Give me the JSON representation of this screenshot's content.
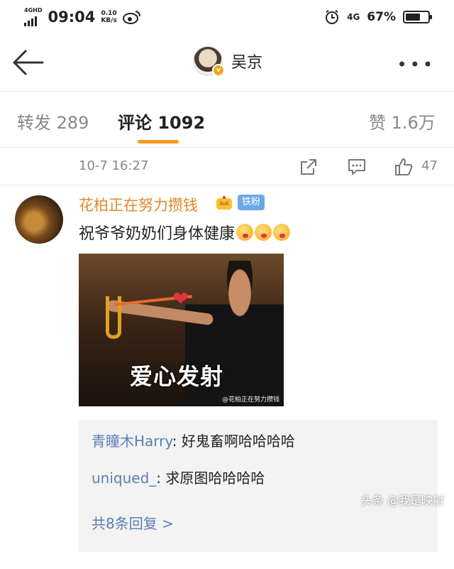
{
  "status_bar": {
    "network": "4GHD",
    "time": "09:04",
    "speed_value": "0.10",
    "speed_unit": "KB/s",
    "network_right": "4G",
    "battery": "67%",
    "battery_level": 0.67
  },
  "nav": {
    "title": "吴京",
    "verified": "v",
    "more": "•••"
  },
  "tabs": {
    "repost_label": "转发",
    "repost_count": "289",
    "comment_label": "评论",
    "comment_count": "1092",
    "like_label": "赞",
    "like_count": "1.6万",
    "active": "comment",
    "accent": "#f39a1b"
  },
  "post_meta": {
    "time": "10-7 16:27",
    "likes": "47"
  },
  "comment": {
    "username": "花柏正在努力攒钱",
    "fan_badge": "铁粉",
    "text": "祝爷爷奶奶们身体健康",
    "emoji_count": 3,
    "image_caption": "爱心发射",
    "image_watermark": "@花柏正在努力攒钱",
    "name_color": "#e2892b"
  },
  "replies": {
    "items": [
      {
        "user": "青瞳木Harry",
        "text": ": 好鬼畜啊哈哈哈哈"
      },
      {
        "user": "uniqued_",
        "text": ": 求原图哈哈哈哈"
      }
    ],
    "more": "共8条回复 >",
    "user_color": "#5a7fb3"
  },
  "footer_watermark": "头条 @我是映射"
}
